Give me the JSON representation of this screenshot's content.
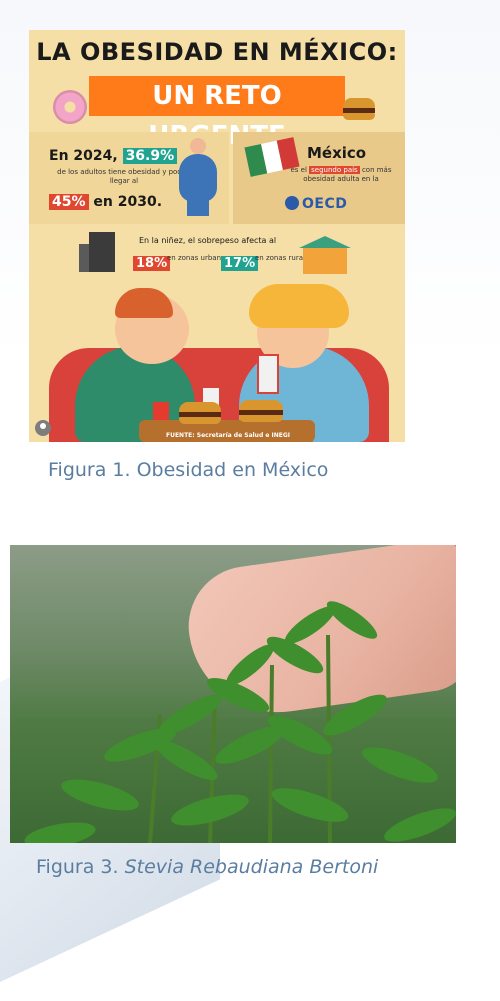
{
  "infographic": {
    "title_line1": "LA OBESIDAD EN MÉXICO:",
    "title_line2": "UN RETO URGENTE",
    "stat": {
      "year_prefix": "En 2024,",
      "pct_now": "36.9%",
      "description": "de los adultos tiene obesidad y podría llegar al",
      "pct_future": "45%",
      "future_suffix": "en 2030."
    },
    "mexico": {
      "title": "México",
      "desc_prefix": "es el",
      "desc_highlight": "segundo país",
      "desc_suffix": "con más obesidad adulta en la",
      "org": "OECD"
    },
    "children": {
      "text": "En la niñez, el sobrepeso afecta al",
      "urban_pct": "18%",
      "urban_label": "en zonas urbanas",
      "rural_pct": "17%",
      "rural_label": "en zonas rurales"
    },
    "source": "FUENTE: Secretaría de Salud e INEGI"
  },
  "captions": {
    "figure1": "Figura 1. Obesidad en México",
    "figure3_prefix": "Figura 3. ",
    "figure3_italic": "Stevia Rebaudiana Bertoni"
  },
  "colors": {
    "caption": "#5b7ea0",
    "accent_orange": "#ff7a18",
    "accent_teal": "#21a38f",
    "accent_red": "#e0472f"
  }
}
